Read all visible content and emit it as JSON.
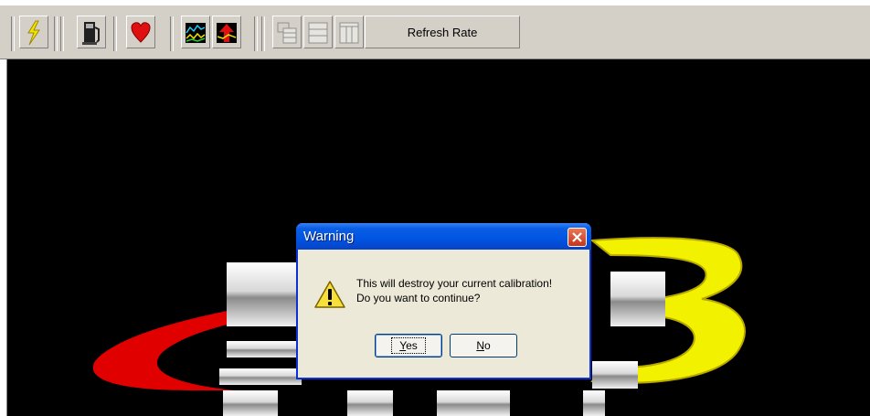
{
  "toolbar": {
    "icons": [
      "lightning-icon",
      "fuel-pump-icon",
      "heart-icon",
      "chart-line-icon",
      "chart-arrow-icon",
      "layout-tile-icon",
      "layout-split-icon",
      "layout-columns-icon"
    ],
    "refresh_label": "Refresh Rate"
  },
  "dialog": {
    "title": "Warning",
    "message_line1": "This will destroy your current calibration!",
    "message_line2": "Do you want to continue?",
    "yes_mnemonic": "Y",
    "yes_rest": "es",
    "no_mnemonic": "N",
    "no_rest": "o"
  },
  "logo": {
    "brand_text": "FAST",
    "number_text": "3"
  },
  "colors": {
    "toolbar_bg": "#d4d0c8",
    "canvas_bg": "#000000",
    "titlebar": "#0054e3",
    "dialog_bg": "#ece9d8",
    "logo_red": "#e00000",
    "logo_yellow": "#f2f200"
  }
}
